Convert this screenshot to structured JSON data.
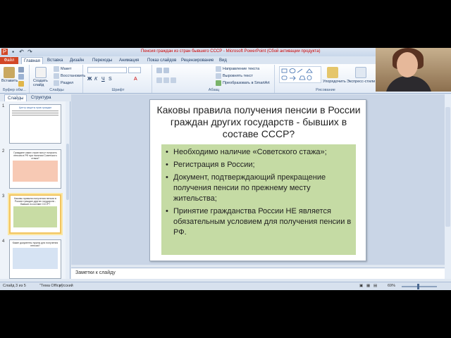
{
  "window": {
    "title": "Пенсия граждан из стран бывшего СССР - Microsoft PowerPoint (Сбой активации продукта)"
  },
  "ribbon": {
    "tabs": [
      "Файл",
      "Главная",
      "Вставка",
      "Дизайн",
      "Переходы",
      "Анимация",
      "Показ слайдов",
      "Рецензирование",
      "Вид"
    ],
    "active_tab": "Главная",
    "clipboard": {
      "paste": "Вставить",
      "label": "Буфер обм..."
    },
    "slides_group": {
      "create": "Создать слайд",
      "layout": "Макет",
      "reset": "Восстановить",
      "section": "Раздел",
      "label": "Слайды"
    },
    "font_label": "Шрифт",
    "paragraph": {
      "label": "Абзац",
      "text_direction": "Направление текста",
      "align_text": "Выровнять текст",
      "smartart": "Преобразовать в SmartArt"
    },
    "drawing": {
      "arrange": "Упорядочить",
      "quick_styles": "Экспресс-стили",
      "label": "Рисование"
    }
  },
  "panel_tabs": [
    "Слайды",
    "Структура"
  ],
  "thumbnails": [
    {
      "num": "1",
      "title": "Центр защиты прав граждан"
    },
    {
      "num": "2",
      "title": "Граждане каких стран могут получать пенсию в РФ при наличии Советского стажа?"
    },
    {
      "num": "3",
      "title": "Каковы правила получения пенсии в России граждан других государств - бывших в составе СССР?"
    },
    {
      "num": "4",
      "title": "Какие документы нужны для получения пенсии?"
    }
  ],
  "slide": {
    "title": "Каковы правила получения пенсии в России граждан других государств - бывших в составе СССР?",
    "bullets": [
      "Необходимо наличие «Советского стажа»;",
      "Регистрация в России;",
      "Документ, подтверждающий прекращение получения пенсии по прежнему месту жительства;",
      "Принятие гражданства России НЕ является обязательным условием для получения пенсии в РФ."
    ],
    "box_color": "#c5dba4"
  },
  "notes_placeholder": "Заметки к слайду",
  "status": {
    "slide_counter": "Слайд 3 из 5",
    "theme": "\"Тема Office\"",
    "language": "русский",
    "zoom": "69%"
  }
}
